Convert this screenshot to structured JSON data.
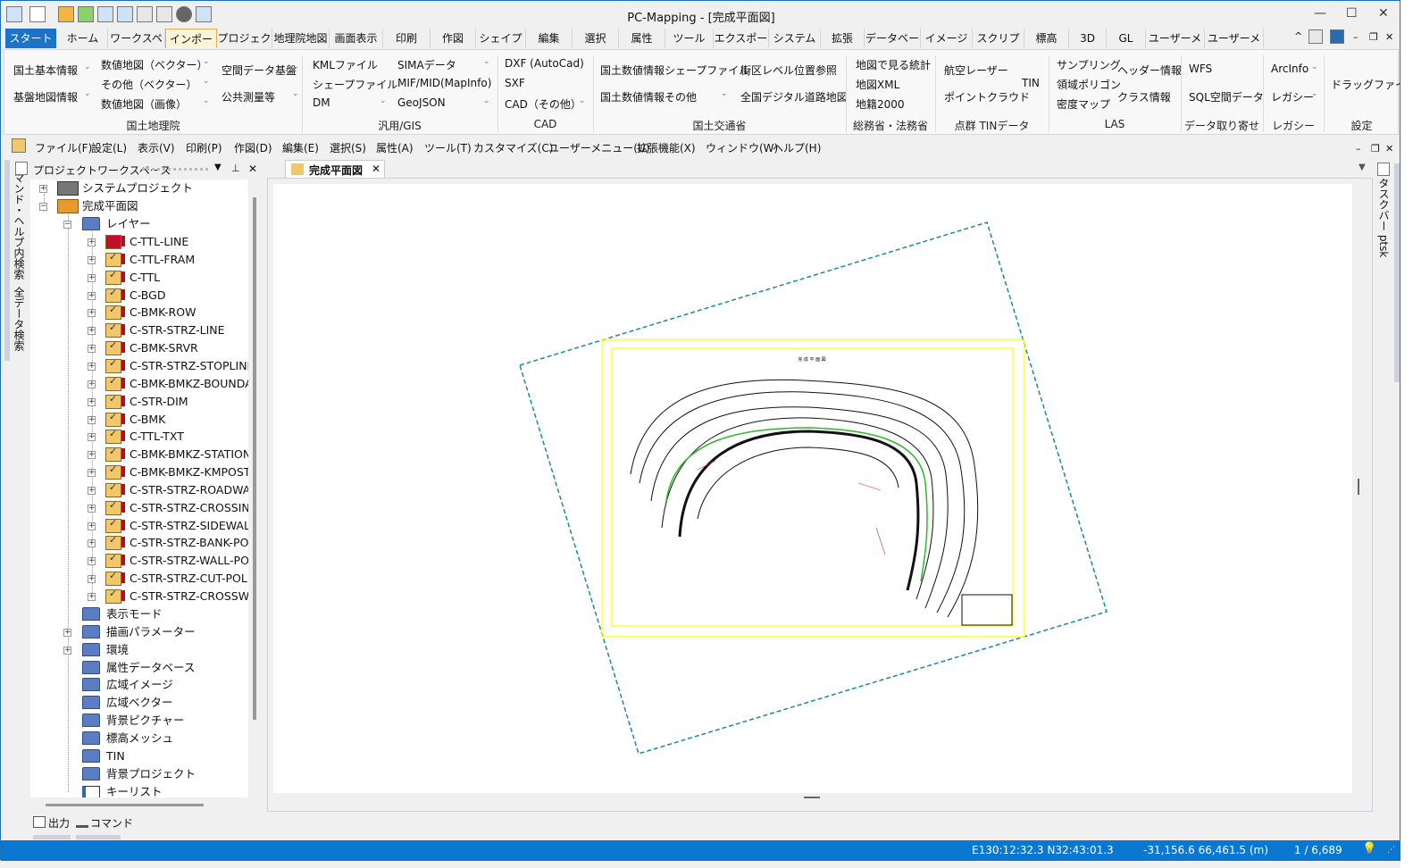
{
  "window": {
    "title": "PC-Mapping - [完成平面図]",
    "minimize": "—",
    "maximize": "☐",
    "close": "✕"
  },
  "ribbon_tabs": [
    "スタート",
    "ホーム",
    "ワークスペー:",
    "インポート",
    "プロジェクト",
    "地理院地図",
    "画面表示",
    "印刷",
    "作図",
    "シェイプ",
    "編集",
    "選択",
    "属性",
    "ツール",
    "エクスポート",
    "システム",
    "拡張",
    "データベース",
    "イメージ",
    "スクリプト",
    "標高",
    "3D",
    "GL",
    "ユーザーメニュ",
    "ユーザーメニュ"
  ],
  "active_tab": "インポート",
  "ribbon": {
    "groups": [
      "国土地理院",
      "汎用/GIS",
      "CAD",
      "国土交通省",
      "総務省・法務省",
      "点群 TINデータ",
      "LAS",
      "データ取り寄せ",
      "レガシー",
      "設定"
    ],
    "items": [
      "国土基本情報",
      "基盤地図情報",
      "数値地図（ベクター）",
      "その他（ベクター）",
      "数値地図（画像）",
      "空間データ基盤",
      "公共測量等",
      "KMLファイル",
      "シェープファイル",
      "DM",
      "SIMAデータ",
      "MIF/MID(MapInfo)",
      "GeoJSON",
      "DXF (AutoCad)",
      "SXF",
      "CAD（その他）",
      "国土数値情報シェープファイル",
      "国土数値情報その他",
      "街区レベル位置参照",
      "全国デジタル道路地図",
      "地図で見る統計",
      "地図XML",
      "地籍2000",
      "航空レーザー",
      "ポイントクラウド",
      "TIN",
      "サンプリング",
      "領域ポリゴン",
      "密度マップ",
      "ヘッダー情報",
      "クラス情報",
      "WFS",
      "SQL空間データ",
      "ArcInfo",
      "レガシー",
      "ドラッグファイル"
    ],
    "dropdown_arrow": "⌄"
  },
  "menu": [
    "ファイル(F)",
    "設定(L)",
    "表示(V)",
    "印刷(P)",
    "作図(D)",
    "編集(E)",
    "選択(S)",
    "属性(A)",
    "ツール(T)",
    "カスタマイズ(C)",
    "ユーザーメニュー(U)",
    "拡張機能(X)",
    "ウィンドウ(W)",
    "ヘルプ(H)"
  ],
  "workspace": {
    "title": "プロジェクトワークスペース",
    "tree": {
      "system": "システムプロジェクト",
      "project": "完成平面図",
      "layers_folder": "レイヤー",
      "layers": [
        "C-TTL-LINE",
        "C-TTL-FRAM",
        "C-TTL",
        "C-BGD",
        "C-BMK-ROW",
        "C-STR-STRZ-LINE",
        "C-BMK-SRVR",
        "C-STR-STRZ-STOPLINE",
        "C-BMK-BMKZ-BOUNDA",
        "C-STR-DIM",
        "C-BMK",
        "C-TTL-TXT",
        "C-BMK-BMKZ-STATION",
        "C-BMK-BMKZ-KMPOST",
        "C-STR-STRZ-ROADWAY",
        "C-STR-STRZ-CROSSINC",
        "C-STR-STRZ-SIDEWALK",
        "C-STR-STRZ-BANK-POL",
        "C-STR-STRZ-WALL-POL",
        "C-STR-STRZ-CUT-POL",
        "C-STR-STRZ-CROSSWA"
      ],
      "folders": [
        "表示モード",
        "描画パラメーター",
        "環境",
        "属性データベース",
        "広域イメージ",
        "広域ベクター",
        "背景ピクチャー",
        "標高メッシュ",
        "TIN",
        "背景プロジェクト",
        "キーリスト"
      ]
    }
  },
  "side_tabs": {
    "left": [
      "コマンド・ヘルプ内検索",
      "全データ検索"
    ],
    "right": "タスクバー ptsk"
  },
  "bottom_tabs": [
    "出力",
    "コマンド"
  ],
  "document": {
    "tab": "完成平面図",
    "drawing_title": "完 成 平 面 図"
  },
  "status": {
    "geo": "E130:12:32.3 N32:43:01.3",
    "xy": "-31,156.6 66,461.5 (m)",
    "scale": "1 / 6,689"
  },
  "colors": {
    "accent": "#0a78d0",
    "frame": "#ffff00",
    "boundary": "#1a8a9a",
    "road": "#2db82d"
  }
}
